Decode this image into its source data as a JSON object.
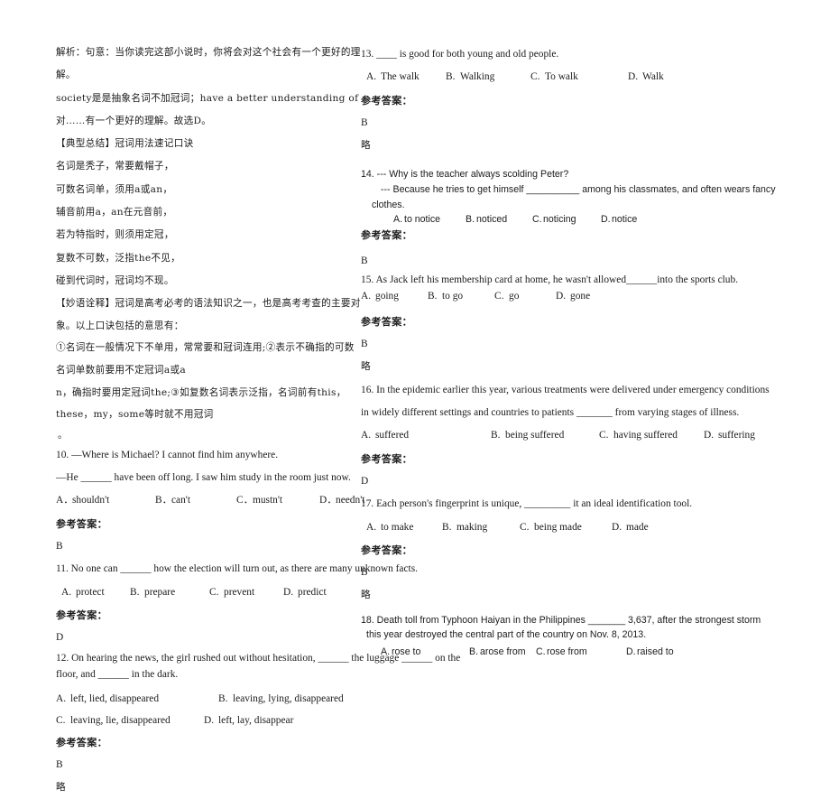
{
  "document": {
    "type": "english-exam-answer-sheet",
    "language_mix": "chinese-english",
    "background_color": "#ffffff",
    "text_color": "#1b1b1b"
  },
  "left_column": {
    "analysis": {
      "line1": "解析：句意：当你读完这部小说时，你将会对这个社会有一个更好的理解。",
      "line2": "society是是抽象名词不加冠词；have a better understanding of对……有一个更好的理解。故选D。"
    },
    "summary_heading": "【典型总结】冠词用法速记口诀",
    "mnemonic_lines": [
      "名词是秃子，常要戴帽子，",
      "可数名词单，须用a或an，",
      "辅音前用a，an在元音前，",
      "若为特指时，则须用定冠，",
      "复数不可数，泛指the不见，",
      "碰到代词时，冠词均不现。"
    ],
    "explanation": {
      "line1": "【妙语诠释】冠词是高考必考的语法知识之一，也是高考考查的主要对象。以上口诀包括的意思有：",
      "line2": "①名词在一般情况下不单用，常常要和冠词连用;②表示不确指的可数名词单数前要用不定冠词a或a",
      "line3": "n，确指时要用定冠词the;③如复数名词表示泛指，名词前有this，these，my，some等时就不用冠词",
      "trailing_mark": "。"
    },
    "questions": [
      {
        "number": "10.",
        "stem_line1": "10. —Where is Michael? I cannot find him anywhere.",
        "stem_line2": "—He ______ have been off long. I saw him study in the room just now.",
        "options": [
          {
            "label": "A．",
            "text": "shouldn't"
          },
          {
            "label": "B．",
            "text": "can't"
          },
          {
            "label": "C．",
            "text": "mustn't"
          },
          {
            "label": "D．",
            "text": "needn't"
          }
        ],
        "answer_heading": "参考答案：",
        "answer": "B",
        "note": ""
      },
      {
        "number": "11.",
        "stem_line1": "11. No one can ______ how the election will turn out, as there are many unknown facts.",
        "options": [
          {
            "label": "A.",
            "text": "protect"
          },
          {
            "label": "B.",
            "text": "prepare"
          },
          {
            "label": "C.",
            "text": "prevent"
          },
          {
            "label": "D.",
            "text": "predict"
          }
        ],
        "answer_heading": "参考答案：",
        "answer": "D",
        "note": ""
      },
      {
        "number": "12.",
        "stem_line1": "12. On hearing the news, the girl rushed out without hesitation, ______ the luggage ______ on the",
        "stem_line2": "floor, and ______ in the dark.",
        "options_row1": [
          {
            "label": "A.",
            "text": "left, lied, disappeared"
          },
          {
            "label": "B.",
            "text": "leaving, lying, disappeared"
          }
        ],
        "options_row2": [
          {
            "label": "C.",
            "text": "leaving, lie, disappeared"
          },
          {
            "label": "D.",
            "text": "left, lay, disappear"
          }
        ],
        "answer_heading": "参考答案：",
        "answer": "B",
        "note": "略"
      }
    ]
  },
  "right_column": {
    "questions": [
      {
        "number": "13.",
        "stem_line1": "13. ____ is good for both young and old people.",
        "options": [
          {
            "label": "A.",
            "text": "The walk"
          },
          {
            "label": "B.",
            "text": "Walking"
          },
          {
            "label": "C.",
            "text": "To walk"
          },
          {
            "label": "D.",
            "text": "Walk"
          }
        ],
        "answer_heading": "参考答案：",
        "answer": "B",
        "note": "略"
      },
      {
        "number": "14.",
        "stem_line1": "14. --- Why is the teacher always scolding Peter?",
        "stem_line2": "--- Because he tries to get himself __________ among his classmates, and often wears fancy",
        "stem_line3": "clothes.",
        "options": [
          {
            "label": "A. ",
            "text": "to notice"
          },
          {
            "label": "B. ",
            "text": "noticed"
          },
          {
            "label": "C. ",
            "text": "noticing"
          },
          {
            "label": "D. ",
            "text": "notice"
          }
        ],
        "answer_heading": "参考答案：",
        "answer": "B",
        "note": ""
      },
      {
        "number": "15.",
        "stem_line1": "15. As Jack left his membership card at home, he wasn't allowed______into the sports club.",
        "options": [
          {
            "label": "A.",
            "text": "going"
          },
          {
            "label": "B.",
            "text": "to go"
          },
          {
            "label": "C.",
            "text": "go"
          },
          {
            "label": "D.",
            "text": "gone"
          }
        ],
        "answer_heading": "参考答案：",
        "answer": "B",
        "note": "略"
      },
      {
        "number": "16.",
        "stem_line1": "16. In the epidemic earlier this year, various treatments were delivered under emergency conditions",
        "stem_line2": "in widely different settings and countries to patients _______ from varying stages of illness.",
        "options": [
          {
            "label": "A.",
            "text": "suffered"
          },
          {
            "label": "B.",
            "text": "being suffered"
          },
          {
            "label": "C.",
            "text": "having suffered"
          },
          {
            "label": "D.",
            "text": "suffering"
          }
        ],
        "answer_heading": "参考答案：",
        "answer": "D",
        "note": ""
      },
      {
        "number": "17.",
        "stem_line1": "17. Each person's fingerprint is unique, _________ it an ideal identification tool.",
        "options": [
          {
            "label": "A.",
            "text": "to make"
          },
          {
            "label": "B.",
            "text": "making"
          },
          {
            "label": "C.",
            "text": "being made"
          },
          {
            "label": "D.",
            "text": "made"
          }
        ],
        "answer_heading": "参考答案：",
        "answer": "B",
        "note": "略"
      },
      {
        "number": "18.",
        "stem_line1": "18. Death toll from Typhoon Haiyan in the Philippines _______ 3,637, after the strongest storm",
        "stem_line2": "this year destroyed the central part of the country on Nov. 8, 2013.",
        "options": [
          {
            "label": "A. ",
            "text": "rose to"
          },
          {
            "label": "B. ",
            "text": "arose from"
          },
          {
            "label": "C. ",
            "text": "rose from"
          },
          {
            "label": "D. ",
            "text": "raised to"
          }
        ]
      }
    ]
  }
}
